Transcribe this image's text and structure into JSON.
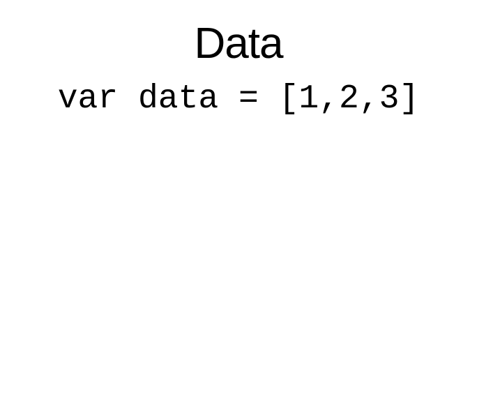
{
  "slide": {
    "title": "Data",
    "code": "var data = [1,2,3]"
  },
  "colors": {
    "background": "#ffffff",
    "text": "#000000"
  }
}
